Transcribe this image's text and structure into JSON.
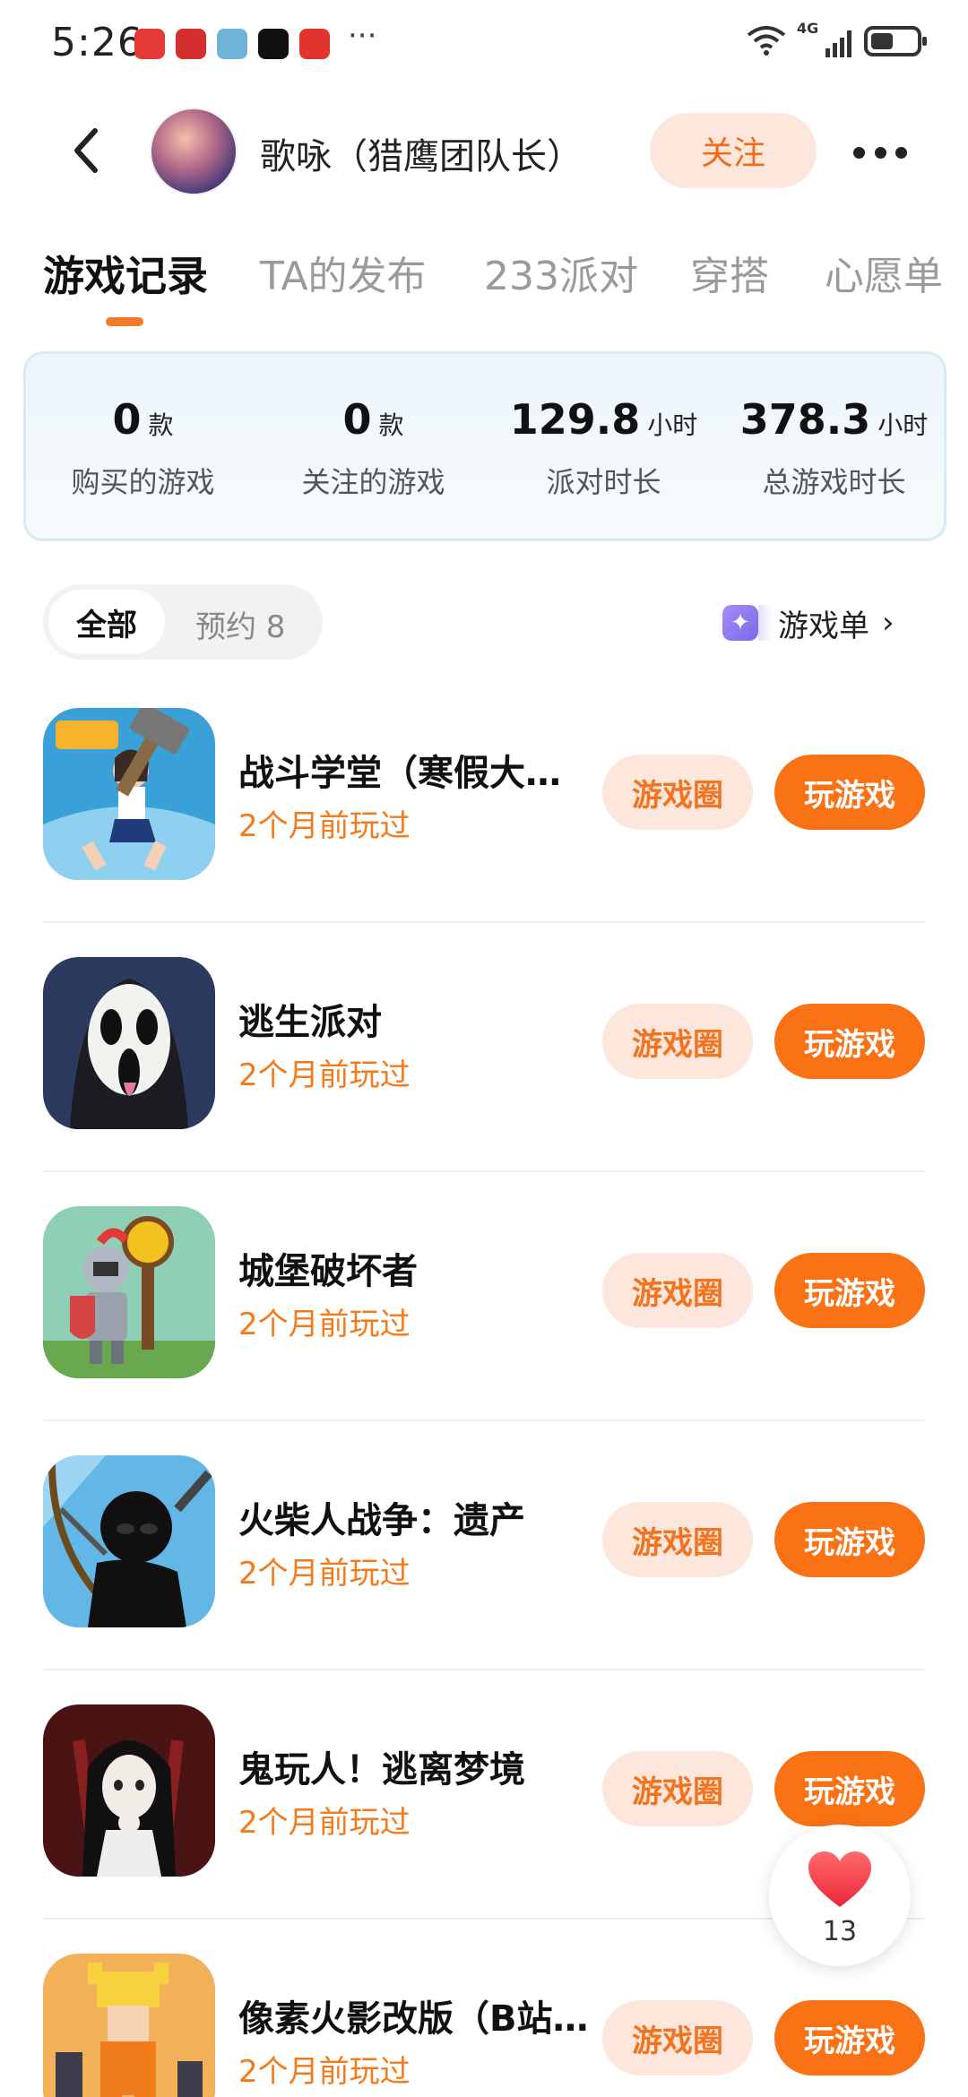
{
  "status_bar": {
    "time": "5:26",
    "more": "···",
    "signal": "4G",
    "app_icons": [
      "app-red-icon",
      "app-red-gift-icon",
      "app-blue-icon",
      "tiktok-icon",
      "app-gold-icon"
    ]
  },
  "header": {
    "username": "歌咏（猎鹰团队长）",
    "follow_label": "关注"
  },
  "tabs": [
    {
      "label": "游戏记录",
      "active": true
    },
    {
      "label": "TA的发布"
    },
    {
      "label": "233派对"
    },
    {
      "label": "穿搭"
    },
    {
      "label": "心愿单"
    }
  ],
  "stats": [
    {
      "value": "0",
      "unit": "款",
      "label": "购买的游戏"
    },
    {
      "value": "0",
      "unit": "款",
      "label": "关注的游戏"
    },
    {
      "value": "129.8",
      "unit": "小时",
      "label": "派对时长"
    },
    {
      "value": "378.3",
      "unit": "小时",
      "label": "总游戏时长"
    }
  ],
  "filter": {
    "all_label": "全部",
    "reserve_label": "预约 8",
    "game_list_label": "游戏单",
    "chevron": "›"
  },
  "games": [
    {
      "title": "战斗学堂（寒假大…",
      "subtitle": "2个月前玩过",
      "circle_label": "游戏圈",
      "play_label": "玩游戏"
    },
    {
      "title": "逃生派对",
      "subtitle": "2个月前玩过",
      "circle_label": "游戏圈",
      "play_label": "玩游戏"
    },
    {
      "title": "城堡破坏者",
      "subtitle": "2个月前玩过",
      "circle_label": "游戏圈",
      "play_label": "玩游戏"
    },
    {
      "title": "火柴人战争：遗产",
      "subtitle": "2个月前玩过",
      "circle_label": "游戏圈",
      "play_label": "玩游戏"
    },
    {
      "title": "鬼玩人！逃离梦境",
      "subtitle": "2个月前玩过",
      "circle_label": "游戏圈",
      "play_label": "玩游戏"
    },
    {
      "title": "像素火影改版（B站…",
      "subtitle": "2个月前玩过",
      "circle_label": "游戏圈",
      "play_label": "玩游戏"
    }
  ],
  "like": {
    "count": "13"
  },
  "colors": {
    "accent": "#f97316",
    "accent_soft": "#fde6dc",
    "subtitle": "#f47a1a",
    "card_border": "#d6ebf3"
  }
}
